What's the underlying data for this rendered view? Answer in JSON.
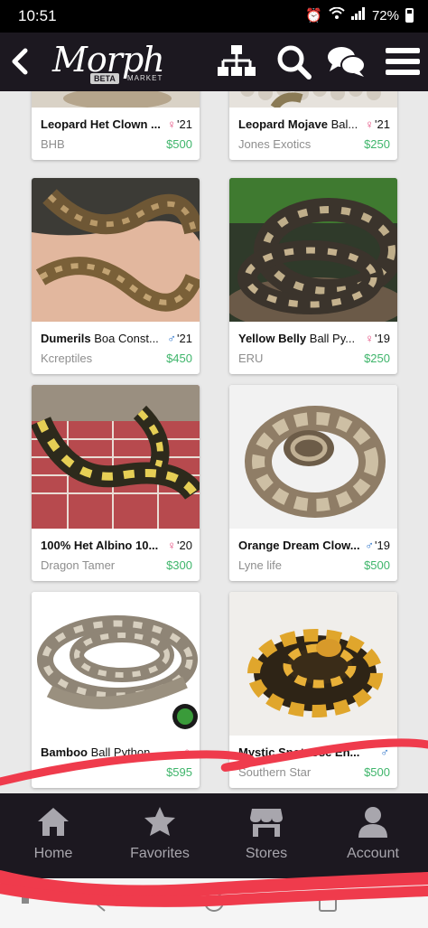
{
  "status": {
    "time": "10:51",
    "battery": "72%"
  },
  "header": {
    "logo_text": "Morph",
    "logo_badge": "BETA",
    "logo_sub": "MARKET"
  },
  "listings": [
    {
      "title_bold": "Leopard Het Clown ...",
      "title_rest": "",
      "sex": "♀",
      "sex_class": "f",
      "year": "'21",
      "seller": "BHB",
      "price": "$500"
    },
    {
      "title_bold": "Leopard Mojave",
      "title_rest": " Bal...",
      "sex": "♀",
      "sex_class": "f",
      "year": "'21",
      "seller": "Jones Exotics",
      "price": "$250"
    },
    {
      "title_bold": "Dumerils",
      "title_rest": " Boa Const...",
      "sex": "♂",
      "sex_class": "m",
      "year": "'21",
      "seller": "Kcreptiles",
      "price": "$450"
    },
    {
      "title_bold": "Yellow Belly",
      "title_rest": " Ball Py...",
      "sex": "♀",
      "sex_class": "f",
      "year": "'19",
      "seller": "ERU",
      "price": "$250"
    },
    {
      "title_bold": "100% Het Albino 10...",
      "title_rest": "",
      "sex": "♀",
      "sex_class": "f",
      "year": "'20",
      "seller": "Dragon Tamer",
      "price": "$300"
    },
    {
      "title_bold": "Orange Dream Clow...",
      "title_rest": "",
      "sex": "♂",
      "sex_class": "m",
      "year": "'19",
      "seller": "Lyne life",
      "price": "$500"
    },
    {
      "title_bold": "Bamboo",
      "title_rest": " Ball Python",
      "sex": "♀",
      "sex_class": "f",
      "year": "",
      "seller": "",
      "price": "$595"
    },
    {
      "title_bold": "Mystic Spotnose En...",
      "title_rest": "",
      "sex": "♂",
      "sex_class": "m",
      "year": "",
      "seller": "Southern Star",
      "price": "$500"
    }
  ],
  "nav": {
    "home": "Home",
    "favorites": "Favorites",
    "stores": "Stores",
    "account": "Account"
  },
  "colors": {
    "header_bg": "#1c1820",
    "price_green": "#3fb56b",
    "female_pink": "#e4467b",
    "male_blue": "#2a72c9",
    "annotation_red": "#ef3b4c"
  },
  "icons": [
    "back-icon",
    "category-tree-icon",
    "search-icon",
    "chat-icon",
    "menu-icon",
    "home-icon",
    "star-icon",
    "store-icon",
    "account-icon"
  ]
}
